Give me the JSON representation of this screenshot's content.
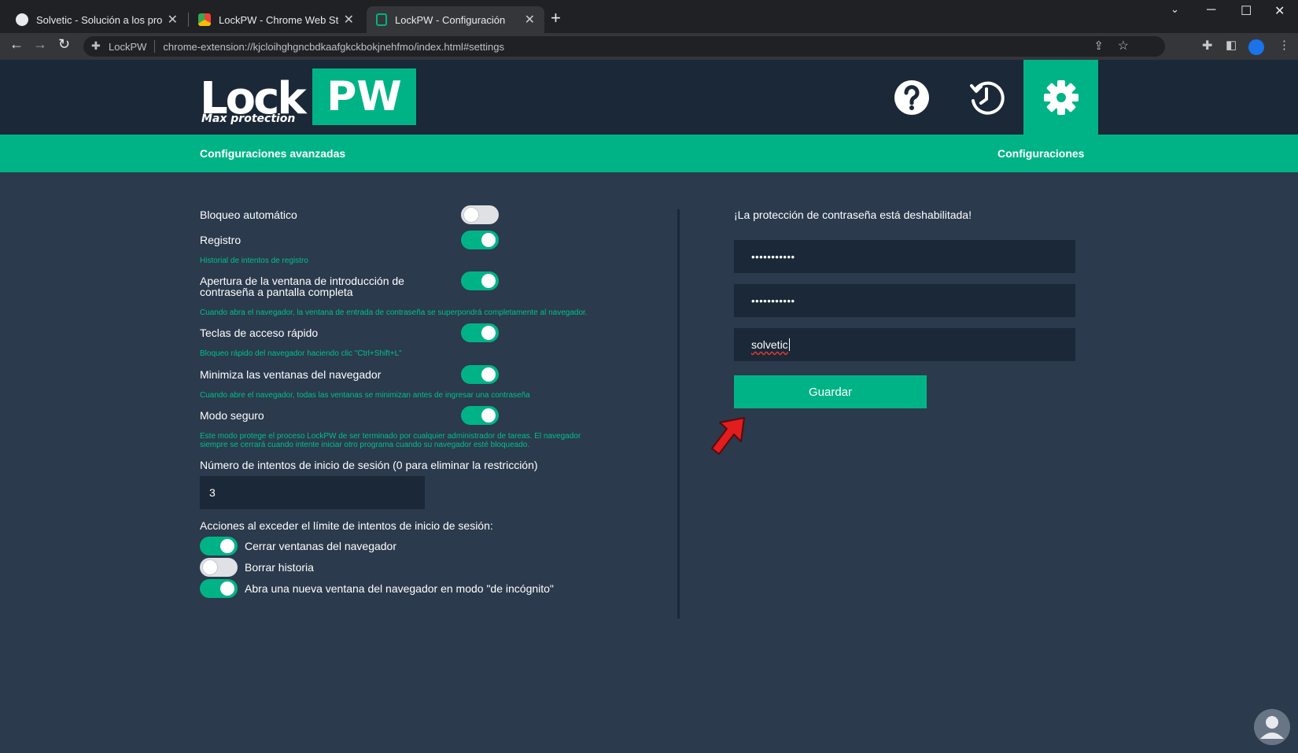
{
  "browser": {
    "tabs": [
      {
        "title": "Solvetic - Solución a los problem",
        "active": false
      },
      {
        "title": "LockPW - Chrome Web Store",
        "active": false
      },
      {
        "title": "LockPW - Configuración",
        "active": true
      }
    ],
    "new_tab": "+",
    "address": {
      "extension_label": "LockPW",
      "url": "chrome-extension://kjcloihghgncbdkaafgkckbokjnehfmo/index.html#settings"
    }
  },
  "header": {
    "logo_lock": "Lock",
    "logo_pw": "PW",
    "logo_sub": "Max protection",
    "accent_color": "#00b386",
    "buttons": [
      {
        "icon": "help-icon",
        "active": false
      },
      {
        "icon": "history-icon",
        "active": false
      },
      {
        "icon": "gear-icon",
        "active": true
      }
    ]
  },
  "subnav": {
    "left": "Configuraciones avanzadas",
    "right": "Configuraciones"
  },
  "settings": {
    "auto_lock": {
      "label": "Bloqueo automático",
      "on": false
    },
    "log": {
      "label": "Registro",
      "on": true,
      "hint": "Historial de intentos de registro"
    },
    "fullscreen": {
      "label_line1": "Apertura de la ventana de introducción de",
      "label_line2": "contraseña a pantalla completa",
      "on": true,
      "hint": "Cuando abra el navegador, la ventana de entrada de contraseña se superpondrá completamente al navegador."
    },
    "hotkeys": {
      "label": "Teclas de acceso rápido",
      "on": true,
      "hint": "Bloqueo rápido del navegador haciendo clic \"Ctrl+Shift+L\""
    },
    "minimize": {
      "label": "Minimiza las ventanas del navegador",
      "on": true,
      "hint": "Cuando abre el navegador, todas las ventanas se minimizan antes de ingresar una contraseña"
    },
    "safe_mode": {
      "label": "Modo seguro",
      "on": true,
      "hint_line1": "Este modo protege el proceso LockPW de ser terminado por cualquier administrador de tareas. El navegador",
      "hint_line2": "siempre se cerrará cuando intente iniciar otro programa cuando su navegador esté bloqueado."
    },
    "attempts": {
      "label": "Número de intentos de inicio de sesión (0 para eliminar la restricción)",
      "value": "3"
    },
    "actions_label": "Acciones al exceder el límite de intentos de inicio de sesión:",
    "actions": [
      {
        "label": "Cerrar ventanas del navegador",
        "on": true
      },
      {
        "label": "Borrar historia",
        "on": false
      },
      {
        "label": "Abra una nueva ventana del navegador en modo \"de incógnito\"",
        "on": true
      }
    ]
  },
  "password_panel": {
    "status": "¡La protección de contraseña está deshabilitada!",
    "password_masked": "•••••••••••",
    "confirm_masked": "•••••••••••",
    "hint_value": "solvetic",
    "save_label": "Guardar"
  }
}
